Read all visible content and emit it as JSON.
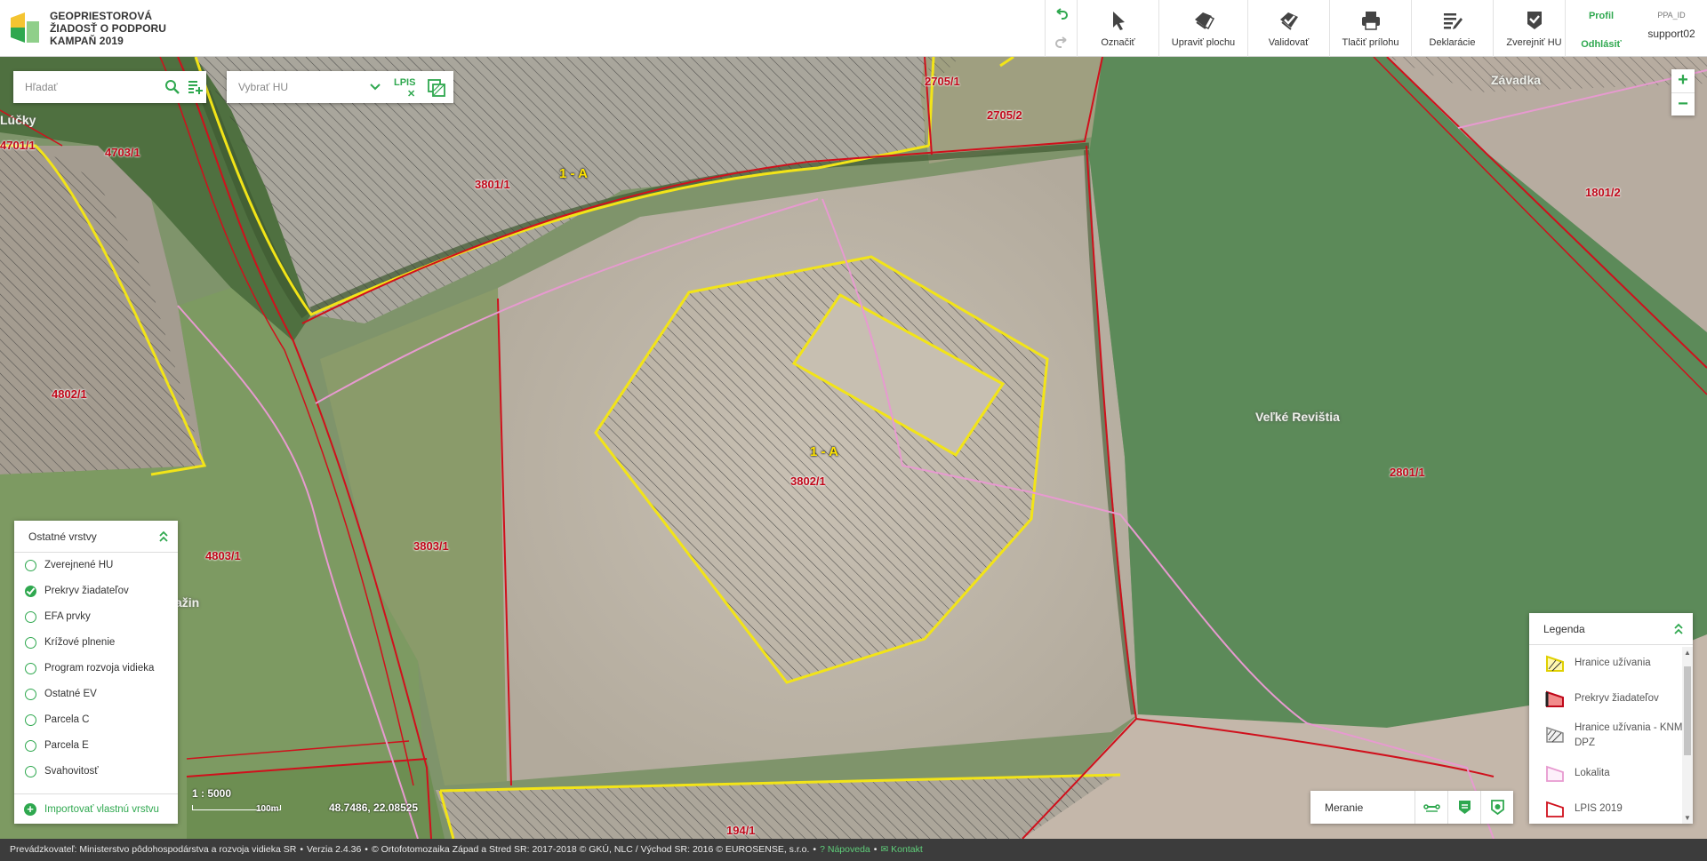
{
  "header": {
    "brand_line1": "GEOPRIESTOROVÁ",
    "brand_line2": "ŽIADOSŤ O PODPORU",
    "brand_line3": "KAMPAŇ 2019",
    "tools": [
      {
        "label": "Označiť",
        "icon": "pointer-icon"
      },
      {
        "label": "Upraviť plochu",
        "icon": "edit-area-icon"
      },
      {
        "label": "Validovať",
        "icon": "validate-icon"
      },
      {
        "label": "Tlačiť prílohu",
        "icon": "printer-icon"
      },
      {
        "label": "Deklarácie",
        "icon": "declaration-icon"
      },
      {
        "label": "Zverejniť HU",
        "icon": "publish-icon"
      }
    ],
    "profile_label": "Profil",
    "logout_label": "Odhlásiť",
    "ppa_label": "PPA_ID",
    "user_id": "support02"
  },
  "search": {
    "placeholder": "Hľadať"
  },
  "hu_select": {
    "value": "Vybrať HU",
    "lpis_label": "LPIS"
  },
  "map_labels": {
    "parcels": [
      "4703/1",
      "4701/1",
      "3801/1",
      "2705/1",
      "2705/2",
      "1801/2",
      "4802/1",
      "3802/1",
      "2801/1",
      "4803/1",
      "3803/1",
      "194/1"
    ],
    "usage_blocks": [
      "1 - A",
      "1 - A"
    ],
    "places": [
      "Lúčky",
      "Závadka",
      "Veľké Revištia",
      "ažin"
    ]
  },
  "layers_panel": {
    "title": "Ostatné vrstvy",
    "items": [
      {
        "label": "Zverejnené HU",
        "checked": false
      },
      {
        "label": "Prekryv žiadateľov",
        "checked": true
      },
      {
        "label": "EFA prvky",
        "checked": false
      },
      {
        "label": "Krížové plnenie",
        "checked": false
      },
      {
        "label": "Program rozvoja vidieka",
        "checked": false
      },
      {
        "label": "Ostatné EV",
        "checked": false
      },
      {
        "label": "Parcela C",
        "checked": false
      },
      {
        "label": "Parcela E",
        "checked": false
      },
      {
        "label": "Svahovitosť",
        "checked": false
      }
    ],
    "import_label": "Importovať vlastnú vrstvu"
  },
  "scale": {
    "ratio": "1 : 5000",
    "bar_label": "100m",
    "coordinates": "48.7486, 22.08525"
  },
  "measure": {
    "label": "Meranie"
  },
  "legend": {
    "title": "Legenda",
    "items": [
      {
        "label": "Hranice užívania",
        "icon": "usage-boundary-icon"
      },
      {
        "label": "Prekryv žiadateľov",
        "icon": "applicant-overlap-icon"
      },
      {
        "label": "Hranice užívania - KNM a DPZ",
        "icon": "usage-boundary-knm-icon"
      },
      {
        "label": "Lokalita",
        "icon": "locality-icon"
      },
      {
        "label": "LPIS 2019",
        "icon": "lpis-icon"
      }
    ]
  },
  "footer": {
    "operator": "Prevádzkovateľ: Ministerstvo pôdohospodárstva a rozvoja vidieka SR",
    "version": "Verzia 2.4.36",
    "copyright": "© Ortofotomozaika Západ a Stred SR: 2017-2018 © GKÚ, NLC / Východ SR: 2016 © EUROSENSE, s.r.o.",
    "help": "Nápoveda",
    "contact": "Kontakt"
  },
  "colors": {
    "accent": "#2fa84f",
    "parcel_label": "#c0081a",
    "usage_boundary": "#f2e418",
    "lpis_boundary": "#d0101c",
    "locality": "#e79ad0"
  }
}
